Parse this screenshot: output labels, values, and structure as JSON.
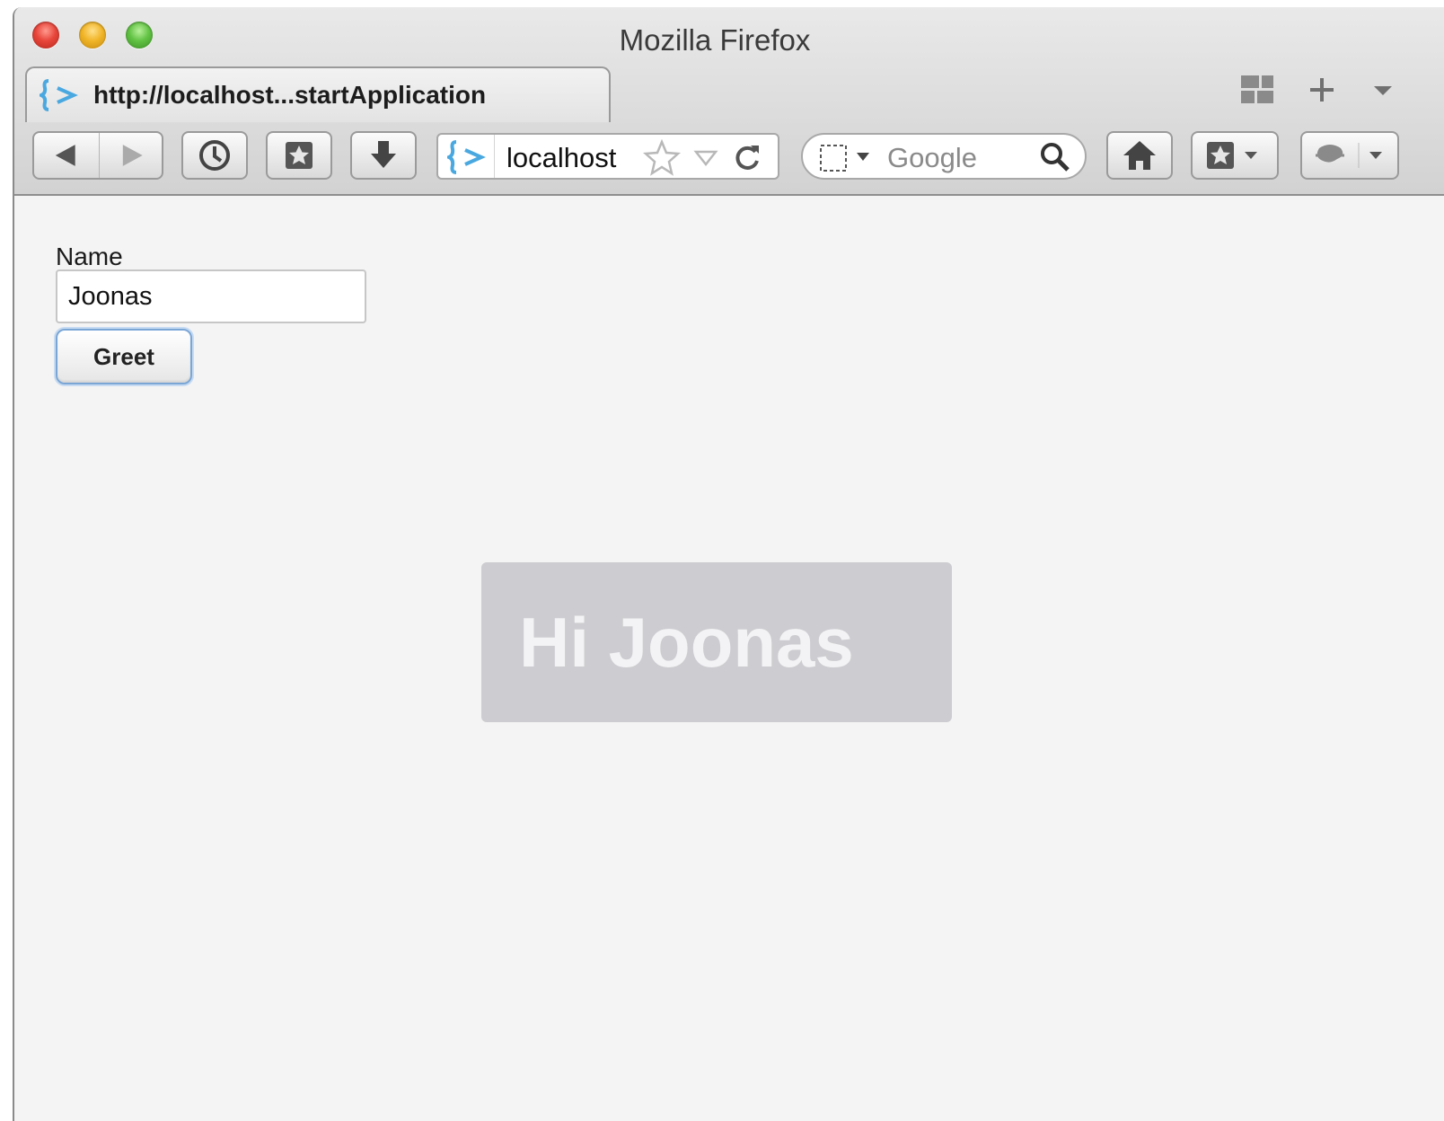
{
  "window": {
    "title": "Mozilla Firefox"
  },
  "tab": {
    "title": "http://localhost...startApplication"
  },
  "navbar": {
    "url": "localhost",
    "search_placeholder": "Google"
  },
  "form": {
    "name_label": "Name",
    "name_value": "Joonas",
    "greet_label": "Greet"
  },
  "notification": {
    "text": "Hi Joonas"
  },
  "colors": {
    "accent_blue": "#4aa8e0",
    "notification_bg": "#cdcdd1",
    "content_bg": "#f4f4f4"
  },
  "icons": [
    "close-icon",
    "minimize-icon",
    "zoom-icon",
    "app-favicon",
    "tab-groups-icon",
    "new-tab-icon",
    "tab-list-icon",
    "back-icon",
    "forward-icon",
    "history-icon",
    "bookmarks-icon",
    "downloads-icon",
    "star-icon",
    "dropmarker-icon",
    "reload-icon",
    "search-engine-icon",
    "search-icon",
    "home-icon",
    "bookmark-menu-icon",
    "addon-icon"
  ]
}
